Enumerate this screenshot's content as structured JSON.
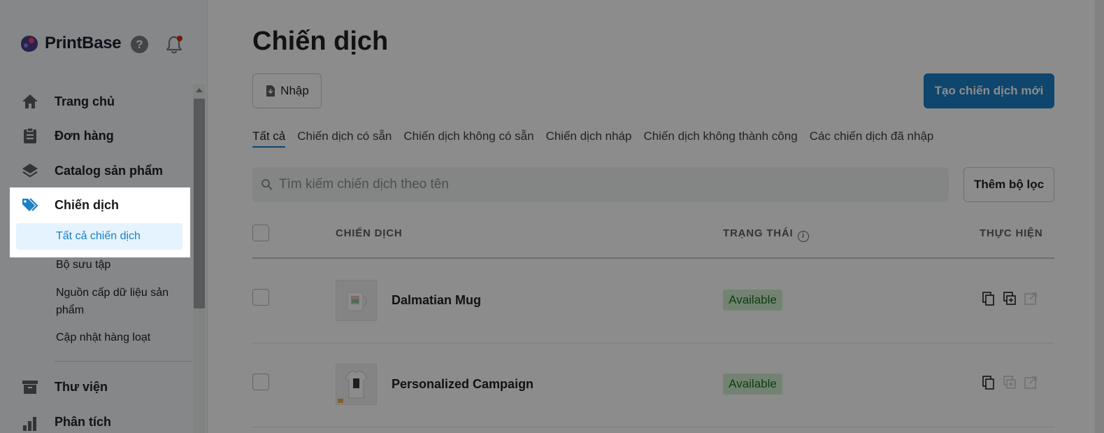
{
  "brand": {
    "name": "PrintBase"
  },
  "header_icons": {
    "help": "?"
  },
  "sidebar": {
    "items": [
      {
        "label": "Trang chủ"
      },
      {
        "label": "Đơn hàng"
      },
      {
        "label": "Catalog sản phẩm"
      },
      {
        "label": "Chiến dịch"
      },
      {
        "label": "Thư viện"
      },
      {
        "label": "Phân tích"
      }
    ],
    "campaign_sub": [
      {
        "label": "Tất cả chiến dịch"
      },
      {
        "label": "Bộ sưu tập"
      },
      {
        "label": "Nguồn cấp dữ liệu sản phẩm"
      },
      {
        "label": "Cập nhật hàng loạt"
      }
    ]
  },
  "page": {
    "title": "Chiến dịch",
    "import_label": "Nhập",
    "create_label": "Tạo chiến dịch mới",
    "tabs": [
      {
        "label": "Tất cả"
      },
      {
        "label": "Chiến dịch có sẵn"
      },
      {
        "label": "Chiến dịch không có sẵn"
      },
      {
        "label": "Chiến dịch nháp"
      },
      {
        "label": "Chiến dịch không thành công"
      },
      {
        "label": "Các chiến dịch đã nhập"
      }
    ],
    "search_placeholder": "Tìm kiếm chiến dịch theo tên",
    "filter_label": "Thêm bộ lọc"
  },
  "table": {
    "columns": {
      "campaign": "CHIẾN DỊCH",
      "status": "TRẠNG THÁI",
      "actions": "THỰC HIỆN"
    },
    "status_info_icon": "i",
    "rows": [
      {
        "name": "Dalmatian Mug",
        "status": "Available"
      },
      {
        "name": "Personalized Campaign",
        "status": "Available"
      }
    ]
  },
  "colors": {
    "accent": "#1b80c6",
    "status_bg": "#cfeecf",
    "status_text": "#1f6d27"
  }
}
